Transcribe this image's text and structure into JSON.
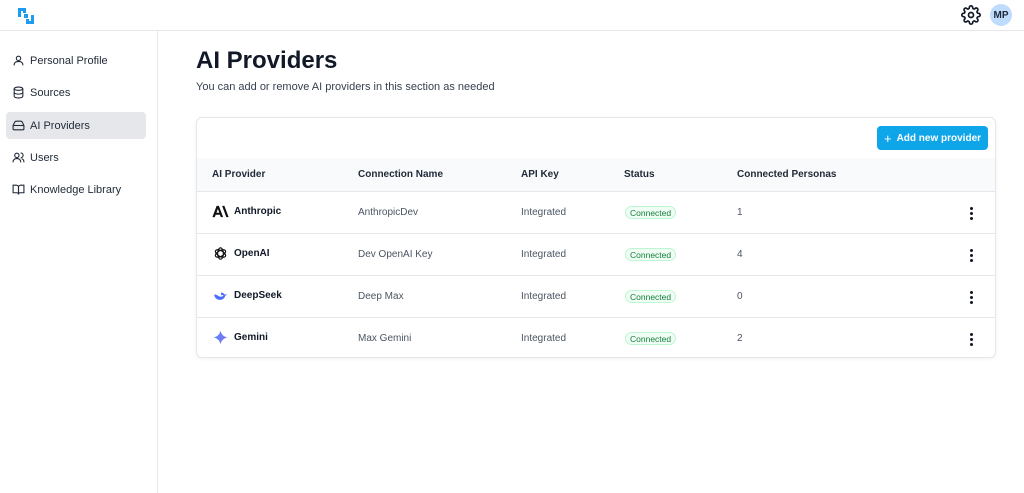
{
  "header": {
    "avatar_initials": "MP",
    "logo_icon": "brand-logo-icon",
    "settings_icon": "gear-icon",
    "brand_color": "#1d9bf0"
  },
  "sidebar": {
    "items": [
      {
        "label": "Personal Profile",
        "icon": "user-icon",
        "active": false
      },
      {
        "label": "Sources",
        "icon": "database-icon",
        "active": false
      },
      {
        "label": "AI Providers",
        "icon": "hard-drive-icon",
        "active": true
      },
      {
        "label": "Users",
        "icon": "users-icon",
        "active": false
      },
      {
        "label": "Knowledge Library",
        "icon": "book-open-icon",
        "active": false
      }
    ]
  },
  "main": {
    "title": "AI Providers",
    "subtitle": "You can add or remove AI providers in this section as needed",
    "add_button_label": "Add new provider",
    "accent_color": "#0ea5e9",
    "table": {
      "columns": [
        "AI Provider",
        "Connection Name",
        "API Key",
        "Status",
        "Connected Personas"
      ],
      "rows": [
        {
          "provider": "Anthropic",
          "icon": "anthropic-logo-icon",
          "connection": "AnthropicDev",
          "api_key": "Integrated",
          "status": "Connected",
          "personas": "1"
        },
        {
          "provider": "OpenAI",
          "icon": "openai-logo-icon",
          "connection": "Dev OpenAI Key",
          "api_key": "Integrated",
          "status": "Connected",
          "personas": "4"
        },
        {
          "provider": "DeepSeek",
          "icon": "deepseek-logo-icon",
          "connection": "Deep Max",
          "api_key": "Integrated",
          "status": "Connected",
          "personas": "0"
        },
        {
          "provider": "Gemini",
          "icon": "gemini-logo-icon",
          "connection": "Max Gemini",
          "api_key": "Integrated",
          "status": "Connected",
          "personas": "2"
        }
      ]
    }
  }
}
